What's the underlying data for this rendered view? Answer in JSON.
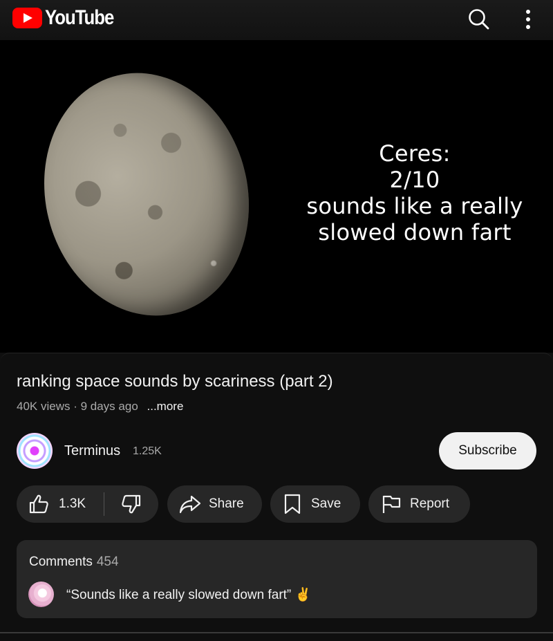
{
  "header": {
    "logo_text": "YouTube",
    "icons": [
      "youtube-logo-icon",
      "search-icon",
      "more-vert-icon"
    ]
  },
  "video": {
    "overlay_lines": [
      "Ceres:",
      "2/10",
      "sounds like a really",
      "slowed down fart"
    ]
  },
  "info": {
    "title": "ranking space sounds by scariness (part 2)",
    "views": "40K views",
    "separator": " · ",
    "age": "9 days ago",
    "more": "...more"
  },
  "channel": {
    "name": "Terminus",
    "subscribers": "1.25K",
    "subscribe_label": "Subscribe"
  },
  "actions": {
    "like_count": "1.3K",
    "share_label": "Share",
    "save_label": "Save",
    "report_label": "Report"
  },
  "comments": {
    "heading": "Comments",
    "count": "454",
    "top_comment": "“Sounds like a really slowed down fart” ✌️"
  },
  "colors": {
    "background": "#0f0f0f",
    "pill": "#272727",
    "youtube_red": "#ff0000",
    "subscribe_bg": "#f1f1f1",
    "secondary_text": "#aaaaaa"
  }
}
